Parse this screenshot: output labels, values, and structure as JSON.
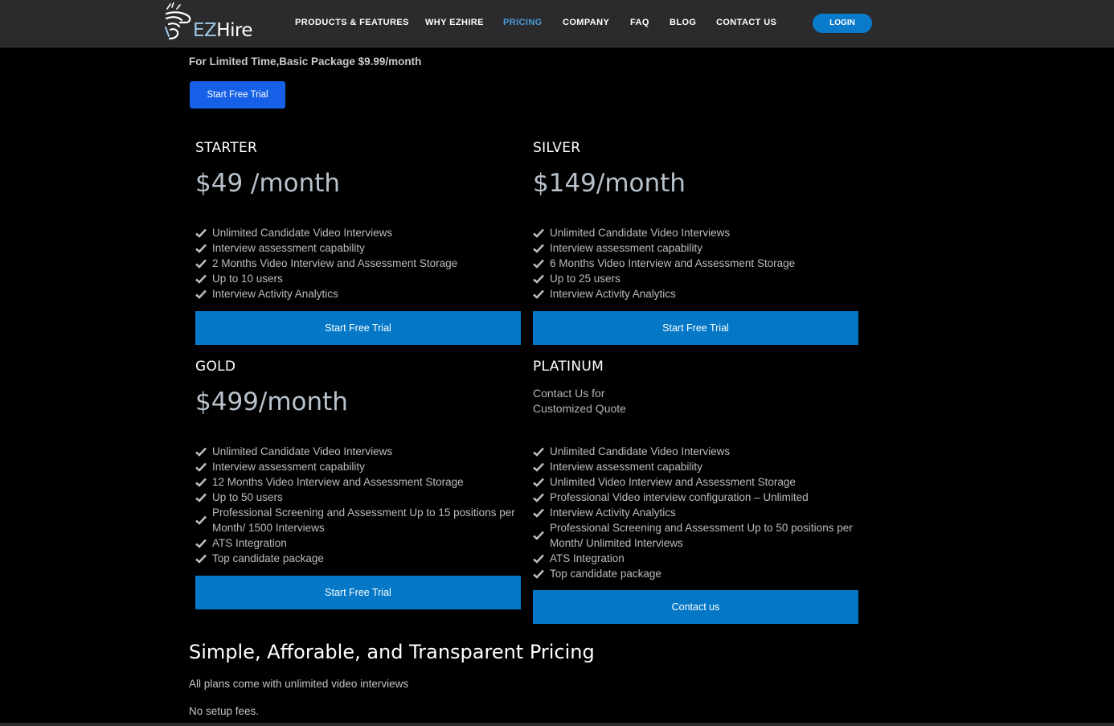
{
  "nav": {
    "logo_text_ez": "EZ",
    "logo_text_hire": "Hire",
    "items": [
      {
        "label": "PRODUCTS & FEATURES"
      },
      {
        "label": "WHY EZHIRE"
      },
      {
        "label": "PRICING"
      },
      {
        "label": "COMPANY"
      },
      {
        "label": "FAQ"
      },
      {
        "label": "BLOG"
      },
      {
        "label": "CONTACT US"
      }
    ],
    "active_item": "PRICING",
    "login_label": "LOGIN"
  },
  "promo": {
    "text": "For Limited Time,Basic Package $9.99/month",
    "button_label": "Start Free Trial"
  },
  "plans": [
    {
      "name": "STARTER",
      "price": "$49 /month",
      "features": [
        "Unlimited Candidate Video Interviews",
        "Interview assessment capability",
        "2 Months Video Interview and Assessment Storage",
        "Up to 10 users",
        "Interview Activity Analytics"
      ],
      "button_label": "Start Free Trial"
    },
    {
      "name": "SILVER",
      "price": "$149/month",
      "features": [
        "Unlimited Candidate Video Interviews",
        "Interview assessment capability",
        "6 Months Video Interview and Assessment Storage",
        "Up to 25 users",
        "Interview Activity Analytics"
      ],
      "button_label": "Start Free Trial"
    },
    {
      "name": "GOLD",
      "price": "$499/month",
      "features": [
        "Unlimited Candidate Video Interviews",
        "Interview assessment capability",
        "12 Months Video Interview and Assessment Storage",
        "Up to 50 users",
        "Professional Screening and Assessment Up to 15 positions per Month/ 1500 Interviews",
        "ATS Integration",
        "Top candidate package"
      ],
      "button_label": "Start Free Trial"
    },
    {
      "name": "PLATINUM",
      "quote_line1": "Contact Us for",
      "quote_line2": "Customized Quote",
      "features": [
        "Unlimited Candidate Video Interviews",
        "Interview assessment capability",
        "Unlimited Video Interview and Assessment Storage",
        "Professional Video interview configuration – Unlimited",
        "Interview Activity Analytics",
        "Professional Screening and Assessment Up to 50 positions per Month/ Unlimited Interviews",
        "ATS Integration",
        "Top candidate package"
      ],
      "button_label": "Contact us"
    }
  ],
  "bottom": {
    "heading": "Simple, Afforable, and Transparent Pricing",
    "line1": "All plans come with unlimited video interviews",
    "line2": "No setup fees."
  },
  "colors": {
    "nav_bg": "#2b2b2d",
    "page_bg": "#000000",
    "accent": "#0478c6",
    "active_nav": "#4a9bd9",
    "promo_button": "#1660e8"
  },
  "icons": [
    "ezhire-logo-icon",
    "check-icon"
  ]
}
